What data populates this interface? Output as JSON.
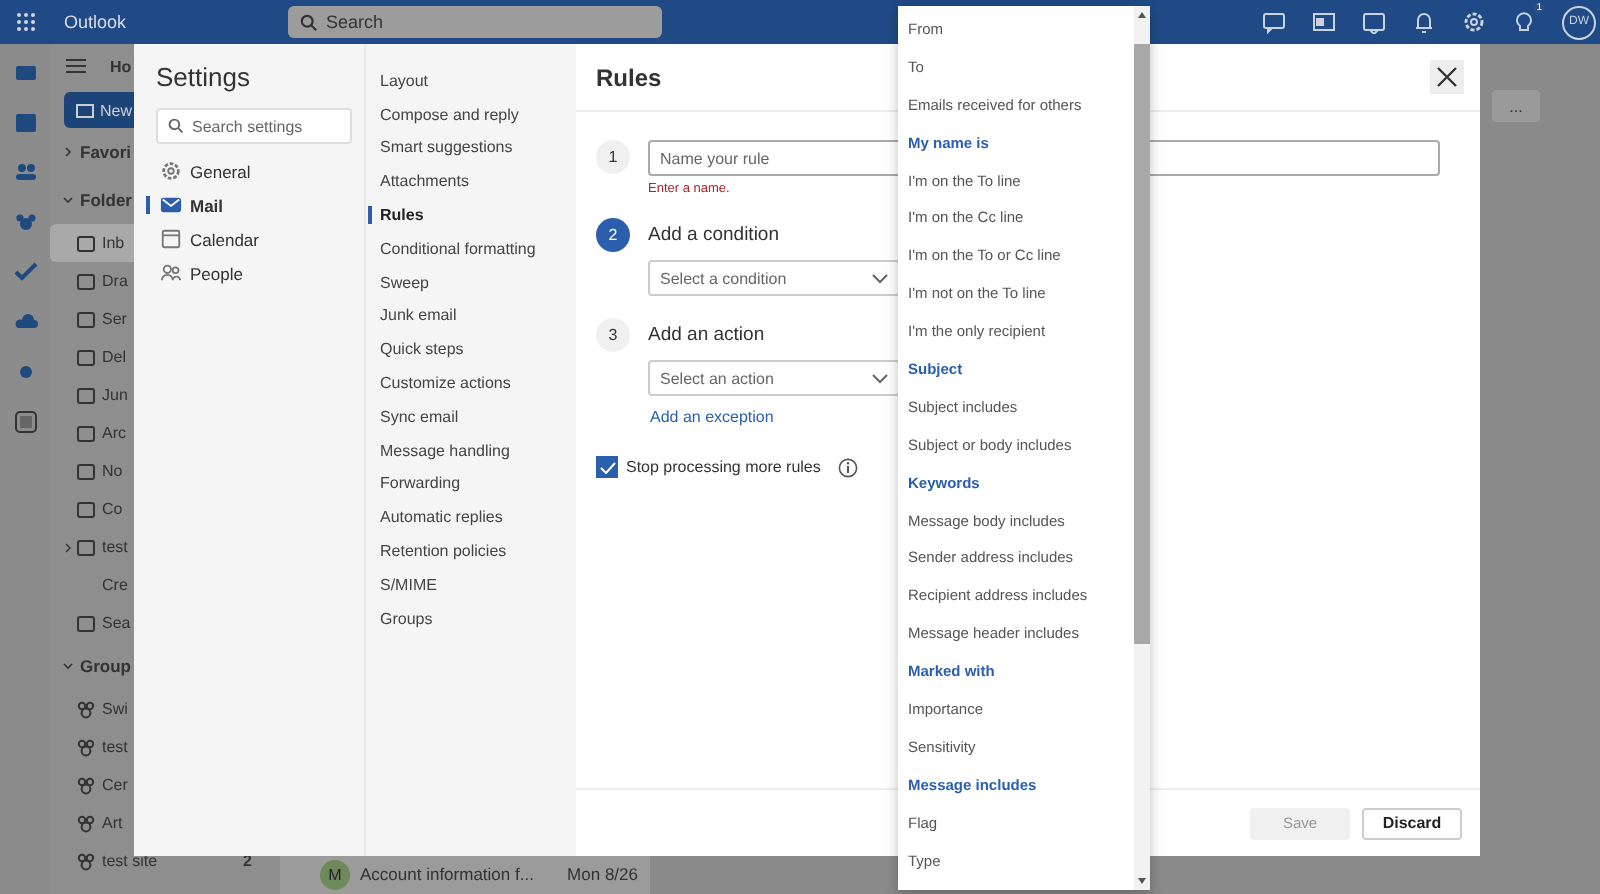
{
  "topbar": {
    "app_name": "Outlook",
    "search_placeholder": "Search",
    "badge": "1",
    "avatar_initials": "DW"
  },
  "folder_pane": {
    "home_tab": "Ho",
    "new_button": "New",
    "sections": [
      {
        "label": "Favori",
        "expanded": false
      },
      {
        "label": "Folder",
        "expanded": true,
        "items": [
          {
            "label": "Inb",
            "selected": true
          },
          {
            "label": "Dra",
            "selected": false
          },
          {
            "label": "Ser",
            "selected": false
          },
          {
            "label": "Del",
            "selected": false
          },
          {
            "label": "Jun",
            "selected": false
          },
          {
            "label": "Arc",
            "selected": false
          },
          {
            "label": "No",
            "selected": false
          },
          {
            "label": "Co",
            "selected": false
          },
          {
            "label": "test",
            "selected": false
          },
          {
            "label": "Cre",
            "selected": false
          },
          {
            "label": "Sea",
            "selected": false
          }
        ]
      },
      {
        "label": "Group",
        "expanded": true,
        "items": [
          {
            "label": "Swi",
            "selected": false
          },
          {
            "label": "test",
            "selected": false
          },
          {
            "label": "Cer",
            "selected": false
          },
          {
            "label": "Art",
            "selected": false
          },
          {
            "label": "test site",
            "selected": false,
            "count": "2"
          }
        ]
      }
    ]
  },
  "message_list": {
    "more": "...",
    "message": {
      "avatar": "M",
      "subject": "Account information f...",
      "date": "Mon 8/26"
    }
  },
  "settings": {
    "title": "Settings",
    "search_placeholder": "Search settings",
    "categories": [
      {
        "label": "General",
        "selected": false
      },
      {
        "label": "Mail",
        "selected": true
      },
      {
        "label": "Calendar",
        "selected": false
      },
      {
        "label": "People",
        "selected": false
      }
    ],
    "subsections": [
      {
        "label": "Layout",
        "selected": false
      },
      {
        "label": "Compose and reply",
        "selected": false
      },
      {
        "label": "Smart suggestions",
        "selected": false
      },
      {
        "label": "Attachments",
        "selected": false
      },
      {
        "label": "Rules",
        "selected": true
      },
      {
        "label": "Conditional formatting",
        "selected": false
      },
      {
        "label": "Sweep",
        "selected": false
      },
      {
        "label": "Junk email",
        "selected": false
      },
      {
        "label": "Quick steps",
        "selected": false
      },
      {
        "label": "Customize actions",
        "selected": false
      },
      {
        "label": "Sync email",
        "selected": false
      },
      {
        "label": "Message handling",
        "selected": false
      },
      {
        "label": "Forwarding",
        "selected": false
      },
      {
        "label": "Automatic replies",
        "selected": false
      },
      {
        "label": "Retention policies",
        "selected": false
      },
      {
        "label": "S/MIME",
        "selected": false
      },
      {
        "label": "Groups",
        "selected": false
      }
    ]
  },
  "rules": {
    "title": "Rules",
    "name_step": {
      "number": "1",
      "placeholder": "Name your rule",
      "error": "Enter a name."
    },
    "steps": [
      {
        "number": "2",
        "active": true,
        "title": "Add a condition",
        "placeholder": "Select a condition"
      },
      {
        "number": "3",
        "active": false,
        "title": "Add an action",
        "placeholder": "Select an action"
      }
    ],
    "add_exception": "Add an exception",
    "stop_processing": {
      "label": "Stop processing more rules",
      "checked": true
    },
    "save": {
      "label": "Save",
      "disabled": true
    },
    "discard": {
      "label": "Discard",
      "disabled": false
    }
  },
  "condition_menu": {
    "items": [
      {
        "kind": "option",
        "label": "From"
      },
      {
        "kind": "option",
        "label": "To"
      },
      {
        "kind": "option",
        "label": "Emails received for others"
      },
      {
        "kind": "header",
        "label": "My name is"
      },
      {
        "kind": "option",
        "label": "I'm on the To line"
      },
      {
        "kind": "option",
        "label": "I'm on the Cc line"
      },
      {
        "kind": "option",
        "label": "I'm on the To or Cc line"
      },
      {
        "kind": "option",
        "label": "I'm not on the To line"
      },
      {
        "kind": "option",
        "label": "I'm the only recipient"
      },
      {
        "kind": "header",
        "label": "Subject"
      },
      {
        "kind": "option",
        "label": "Subject includes"
      },
      {
        "kind": "option",
        "label": "Subject or body includes"
      },
      {
        "kind": "header",
        "label": "Keywords"
      },
      {
        "kind": "option",
        "label": "Message body includes"
      },
      {
        "kind": "option",
        "label": "Sender address includes"
      },
      {
        "kind": "option",
        "label": "Recipient address includes"
      },
      {
        "kind": "option",
        "label": "Message header includes"
      },
      {
        "kind": "header",
        "label": "Marked with"
      },
      {
        "kind": "option",
        "label": "Importance"
      },
      {
        "kind": "option",
        "label": "Sensitivity"
      },
      {
        "kind": "header",
        "label": "Message includes"
      },
      {
        "kind": "option",
        "label": "Flag"
      },
      {
        "kind": "option",
        "label": "Type"
      }
    ]
  }
}
